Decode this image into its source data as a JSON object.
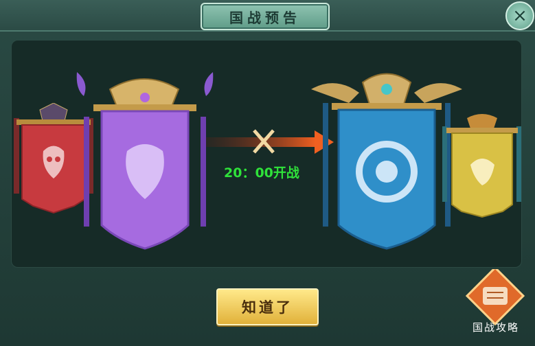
{
  "dialog": {
    "title": "国战预告",
    "countdown": "20：00开战",
    "confirm_label": "知道了",
    "guide_label": "国战攻略",
    "close_symbol": "×"
  },
  "icons": {
    "close": "close-icon",
    "crossed_swords": "crossed-swords-icon",
    "guide": "scroll-guide-icon"
  },
  "banners": [
    {
      "faction": "red",
      "emblem": "demon-mask-icon",
      "color": "#c73a3f"
    },
    {
      "faction": "purple",
      "emblem": "flame-fox-icon",
      "color": "#a66be0"
    },
    {
      "faction": "blue",
      "emblem": "dragon-icon",
      "color": "#2f8fc9"
    },
    {
      "faction": "yellow",
      "emblem": "phoenix-icon",
      "color": "#d9c145"
    }
  ],
  "colors": {
    "countdown": "#2fe23a",
    "arrow": "#e9501f"
  }
}
